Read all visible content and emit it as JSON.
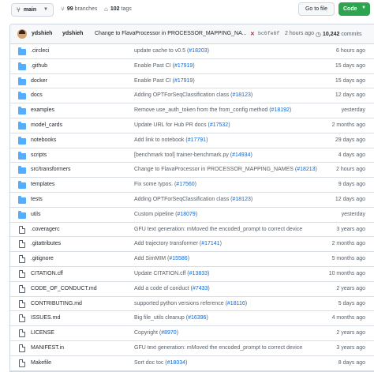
{
  "toolbar": {
    "branch": "main",
    "branches_count": "99",
    "branches_label": "branches",
    "tags_count": "102",
    "tags_label": "tags",
    "goto_file": "Go to file",
    "code": "Code"
  },
  "commit": {
    "author1": "ydshieh",
    "author2": "ydshieh",
    "message": "Change to FlavaProcessor in PROCESSOR_MAPPING_NA...",
    "status": "✕",
    "sha": "bc6fe6f",
    "time": "2 hours ago",
    "commits_count": "10,242",
    "commits_label": "commits"
  },
  "files": [
    {
      "type": "folder",
      "name": ".circleci",
      "msg": "update cache to v0.5 (",
      "pr": "#18203",
      "msg_end": ")",
      "age": "6 hours ago"
    },
    {
      "type": "folder",
      "name": ".github",
      "msg": "Enable Past CI (",
      "pr": "#17919",
      "msg_end": ")",
      "age": "15 days ago"
    },
    {
      "type": "folder",
      "name": "docker",
      "msg": "Enable Past CI (",
      "pr": "#17919",
      "msg_end": ")",
      "age": "15 days ago"
    },
    {
      "type": "folder",
      "name": "docs",
      "msg": "Adding OPTForSeqClassification class (",
      "pr": "#18123",
      "msg_end": ")",
      "age": "12 days ago"
    },
    {
      "type": "folder",
      "name": "examples",
      "msg": "Remove use_auth_token from the from_config method (",
      "pr": "#18192",
      "msg_end": ")",
      "age": "yesterday"
    },
    {
      "type": "folder",
      "name": "model_cards",
      "msg": "Update URL for Hub PR docs (",
      "pr": "#17532",
      "msg_end": ")",
      "age": "2 months ago"
    },
    {
      "type": "folder",
      "name": "notebooks",
      "msg": "Add link to notebook (",
      "pr": "#17791",
      "msg_end": ")",
      "age": "29 days ago"
    },
    {
      "type": "folder",
      "name": "scripts",
      "msg": "[benchmark tool] trainer-benchmark.py (",
      "pr": "#14934",
      "msg_end": ")",
      "age": "4 days ago"
    },
    {
      "type": "folder",
      "name": "src/transformers",
      "msg": "Change to FlavaProcessor in PROCESSOR_MAPPING_NAMES (",
      "pr": "#18213",
      "msg_end": ")",
      "age": "2 hours ago"
    },
    {
      "type": "folder",
      "name": "templates",
      "msg": "Fix some typos. (",
      "pr": "#17560",
      "msg_end": ")",
      "age": "9 days ago"
    },
    {
      "type": "folder",
      "name": "tests",
      "msg": "Adding OPTForSeqClassification class (",
      "pr": "#18123",
      "msg_end": ")",
      "age": "12 days ago"
    },
    {
      "type": "folder",
      "name": "utils",
      "msg": "Custom pipeline (",
      "pr": "#18079",
      "msg_end": ")",
      "age": "yesterday"
    },
    {
      "type": "file",
      "name": ".coveragerc",
      "msg": "GFU text generation: mMoved the encoded_prompt to correct device",
      "pr": "",
      "msg_end": "",
      "age": "3 years ago"
    },
    {
      "type": "file",
      "name": ".gitattributes",
      "msg": "Add trajectory transformer (",
      "pr": "#17141",
      "msg_end": ")",
      "age": "2 months ago"
    },
    {
      "type": "file",
      "name": ".gitignore",
      "msg": "Add SimMIM (",
      "pr": "#15586",
      "msg_end": ")",
      "age": "5 months ago"
    },
    {
      "type": "file",
      "name": "CITATION.cff",
      "msg": "Update CITATION.cff (",
      "pr": "#13833",
      "msg_end": ")",
      "age": "10 months ago"
    },
    {
      "type": "file",
      "name": "CODE_OF_CONDUCT.md",
      "msg": "Add a code of conduct (",
      "pr": "#7433",
      "msg_end": ")",
      "age": "2 years ago"
    },
    {
      "type": "file",
      "name": "CONTRIBUTING.md",
      "msg": "supported python versions reference (",
      "pr": "#18116",
      "msg_end": ")",
      "age": "5 days ago"
    },
    {
      "type": "file",
      "name": "ISSUES.md",
      "msg": "Big file_utils cleanup (",
      "pr": "#16396",
      "msg_end": ")",
      "age": "4 months ago"
    },
    {
      "type": "file",
      "name": "LICENSE",
      "msg": "Copyright (",
      "pr": "#8970",
      "msg_end": ")",
      "age": "2 years ago"
    },
    {
      "type": "file",
      "name": "MANIFEST.in",
      "msg": "GFU text generation: mMoved the encoded_prompt to correct device",
      "pr": "",
      "msg_end": "",
      "age": "3 years ago"
    },
    {
      "type": "file",
      "name": "Makefile",
      "msg": "Sort doc toc (",
      "pr": "#18034",
      "msg_end": ")",
      "age": "8 days ago"
    }
  ]
}
